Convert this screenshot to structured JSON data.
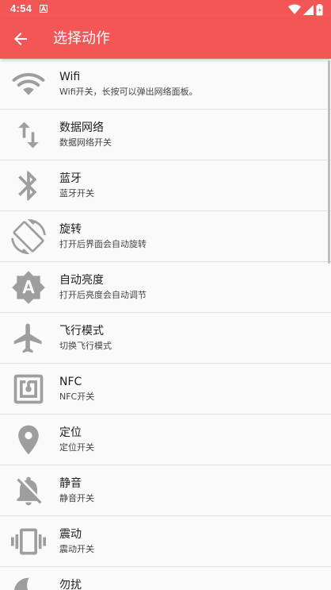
{
  "status_bar": {
    "time": "4:54"
  },
  "app_bar": {
    "title": "选择动作"
  },
  "items": [
    {
      "label": "Wifi",
      "sub": "Wifi开关，长按可以弹出网络面板。",
      "icon": "wifi-icon"
    },
    {
      "label": "数据网络",
      "sub": "数据网络开关",
      "icon": "mobile-data-icon"
    },
    {
      "label": "蓝牙",
      "sub": "蓝牙开关",
      "icon": "bluetooth-icon"
    },
    {
      "label": "旋转",
      "sub": "打开后界面会自动旋转",
      "icon": "rotate-icon"
    },
    {
      "label": "自动亮度",
      "sub": "打开后亮度会自动调节",
      "icon": "auto-brightness-icon"
    },
    {
      "label": "飞行模式",
      "sub": "切换飞行模式",
      "icon": "airplane-icon"
    },
    {
      "label": "NFC",
      "sub": "NFC开关",
      "icon": "nfc-icon"
    },
    {
      "label": "定位",
      "sub": "定位开关",
      "icon": "location-icon"
    },
    {
      "label": "静音",
      "sub": "静音开关",
      "icon": "mute-icon"
    },
    {
      "label": "震动",
      "sub": "震动开关",
      "icon": "vibrate-icon"
    },
    {
      "label": "勿扰",
      "sub": "",
      "icon": "do-not-disturb-icon"
    }
  ],
  "colors": {
    "primary": "#f45555",
    "icon_gray": "#9e9e9e",
    "divider": "#e0e0e0"
  }
}
